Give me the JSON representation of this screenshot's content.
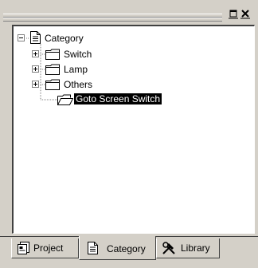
{
  "tree": {
    "root": {
      "label": "Category"
    },
    "items": [
      {
        "label": "Switch"
      },
      {
        "label": "Lamp"
      },
      {
        "label": "Others"
      },
      {
        "label": "Goto Screen Switch"
      }
    ]
  },
  "tabs": [
    {
      "label": "Project",
      "icon": "project-icon"
    },
    {
      "label": "Category",
      "icon": "category-icon",
      "active": true
    },
    {
      "label": "Library",
      "icon": "library-tools-icon"
    }
  ],
  "colors": {
    "face": "#d4d0c8",
    "selection": "#000000",
    "folder": "#ffffff"
  }
}
